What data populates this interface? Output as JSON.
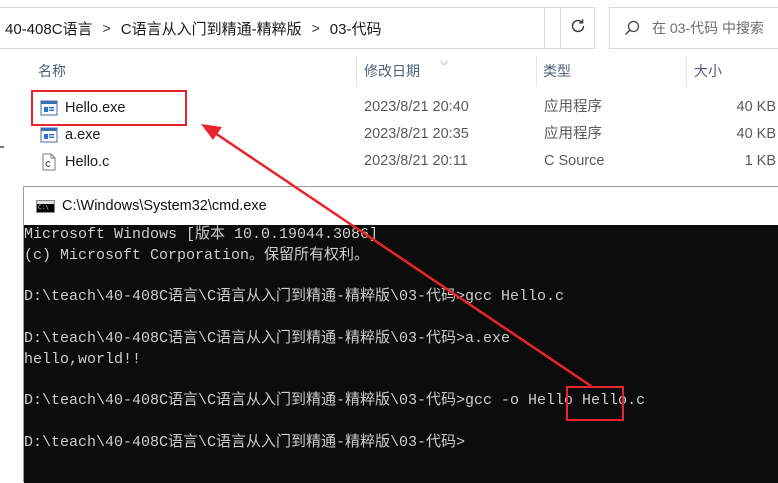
{
  "address_bar": {
    "breadcrumbs": [
      "40-408C语言",
      "C语言从入门到精通-精粹版",
      "03-代码"
    ],
    "separator": ">",
    "search_placeholder": "在 03-代码 中搜索"
  },
  "file_list": {
    "columns": {
      "name": "名称",
      "modified": "修改日期",
      "type": "类型",
      "size": "大小"
    },
    "files": [
      {
        "name": "Hello.exe",
        "modified": "2023/8/21 20:40",
        "type": "应用程序",
        "size": "40 KB",
        "icon": "exe-icon"
      },
      {
        "name": "a.exe",
        "modified": "2023/8/21 20:35",
        "type": "应用程序",
        "size": "40 KB",
        "icon": "exe-icon"
      },
      {
        "name": "Hello.c",
        "modified": "2023/8/21 20:11",
        "type": "C Source",
        "size": "1 KB",
        "icon": "c-source-file-icon"
      }
    ]
  },
  "cmd": {
    "title": "C:\\Windows\\System32\\cmd.exe",
    "icon_text": "C:\\",
    "lines": [
      "Microsoft Windows [版本 10.0.19044.3086]",
      "(c) Microsoft Corporation。保留所有权利。",
      "",
      "D:\\teach\\40-408C语言\\C语言从入门到精通-精粹版\\03-代码>gcc Hello.c",
      "",
      "D:\\teach\\40-408C语言\\C语言从入门到精通-精粹版\\03-代码>a.exe",
      "hello,world!!",
      "",
      "D:\\teach\\40-408C语言\\C语言从入门到精通-精粹版\\03-代码>gcc -o Hello Hello.c",
      "",
      "D:\\teach\\40-408C语言\\C语言从入门到精通-精粹版\\03-代码>"
    ]
  },
  "colors": {
    "annotation_red": "#e8242d",
    "console_bg": "#0c0c0c",
    "console_fg": "#cccccc",
    "header_text": "#4c607a"
  }
}
